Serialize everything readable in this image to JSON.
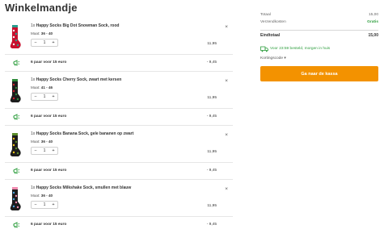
{
  "page": {
    "title": "Winkelmandje"
  },
  "cart": {
    "items": [
      {
        "qty_prefix": "1x",
        "name": "Happy Socks Big Dot Snowman Sock, rood",
        "size_label": "Maat:",
        "size": "36 - 40",
        "quantity": "1",
        "price": "11,95",
        "colors": [
          "#c8102e",
          "#f2f2f2",
          "#2a9d8f"
        ]
      },
      {
        "qty_prefix": "1x",
        "name": "Happy Socks Cherry Sock, zwart met kersen",
        "size_label": "Maat:",
        "size": "41 - 46",
        "quantity": "1",
        "price": "11,95",
        "colors": [
          "#1d1d1d",
          "#d0202d",
          "#2e8b3a"
        ]
      },
      {
        "qty_prefix": "1x",
        "name": "Happy Socks Banana Sock, gele bananen op zwart",
        "size_label": "Maat:",
        "size": "36 - 40",
        "quantity": "1",
        "price": "11,95",
        "colors": [
          "#1d1d1d",
          "#f5c518",
          "#5b8c2a"
        ]
      },
      {
        "qty_prefix": "1x",
        "name": "Happy Socks Milkshake Sock, smullen met blauw",
        "size_label": "Maat:",
        "size": "36 - 40",
        "quantity": "1",
        "price": "11,95",
        "colors": [
          "#1d1d1d",
          "#4aa3df",
          "#f28cb1"
        ]
      }
    ],
    "promos": [
      {
        "text": "6 paar voor 15 euro",
        "discount": "- 9,45"
      },
      {
        "text": "6 paar voor 15 euro",
        "discount": "- 9,45"
      },
      {
        "text": "6 paar voor 15 euro",
        "discount": "- 9,45"
      },
      {
        "text": "6 paar voor 15 euro",
        "discount": "- 9,45"
      }
    ],
    "stepper": {
      "minus": "−",
      "plus": "+"
    },
    "remove_symbol": "×"
  },
  "summary": {
    "subtotal_label": "Totaal",
    "subtotal_value": "15,00",
    "shipping_label": "Verzendkosten",
    "shipping_value": "Gratis",
    "total_label": "Eindtotaal",
    "total_value": "15,00",
    "delivery_text": "Voor 23:59 besteld, morgen in huis",
    "coupon_label": "Kortingscode",
    "checkout_label": "Ga naar de kassa"
  },
  "colors": {
    "accent": "#f39200",
    "success": "#2e9e3e"
  }
}
